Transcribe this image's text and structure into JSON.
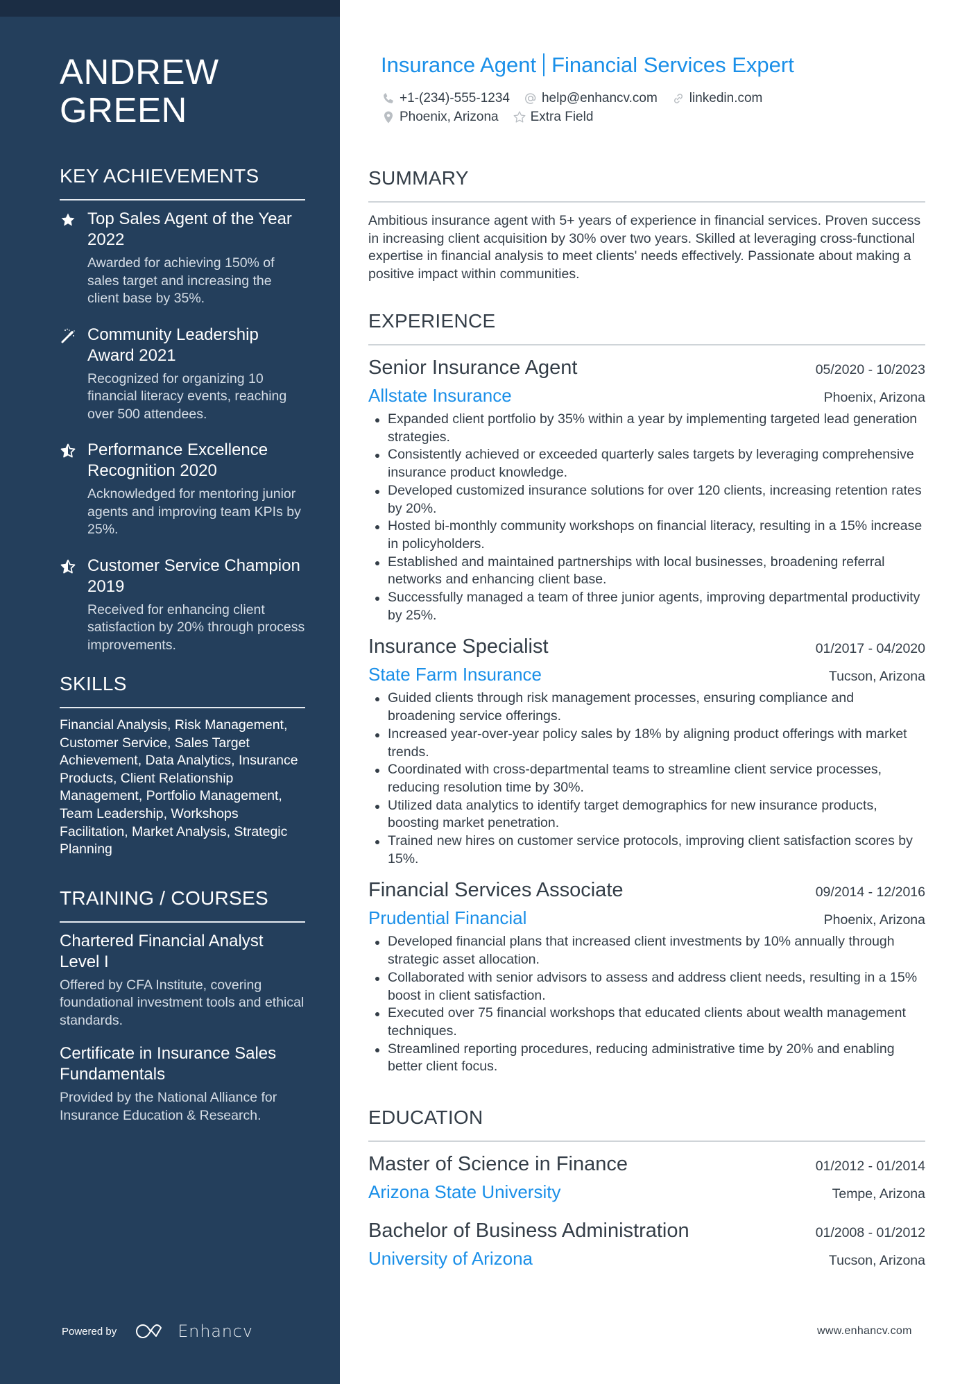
{
  "person": {
    "first_name": "ANDREW",
    "last_name": "GREEN",
    "title_part1": "Insurance Agent",
    "title_part2": "Financial Services Expert"
  },
  "contacts": {
    "phone": {
      "icon": "phone-icon",
      "value": "+1-(234)-555-1234"
    },
    "email": {
      "icon": "at-icon",
      "value": "help@enhancv.com"
    },
    "link": {
      "icon": "link-icon",
      "value": "linkedin.com"
    },
    "location": {
      "icon": "location-pin-icon",
      "value": "Phoenix, Arizona"
    },
    "extra": {
      "icon": "star-outline-icon",
      "value": "Extra Field"
    }
  },
  "sidebar": {
    "achievements": {
      "heading": "KEY ACHIEVEMENTS",
      "items": [
        {
          "icon": "star-filled-icon",
          "title": "Top Sales Agent of the Year 2022",
          "description": "Awarded for achieving 150% of sales target and increasing the client base by 35%."
        },
        {
          "icon": "magic-wand-icon",
          "title": "Community Leadership Award 2021",
          "description": "Recognized for organizing 10 financial literacy events, reaching over 500 attendees."
        },
        {
          "icon": "star-half-icon",
          "title": "Performance Excellence Recognition 2020",
          "description": "Acknowledged for mentoring junior agents and improving team KPIs by 25%."
        },
        {
          "icon": "star-half-icon",
          "title": "Customer Service Champion 2019",
          "description": "Received for enhancing client satisfaction by 20% through process improvements."
        }
      ]
    },
    "skills": {
      "heading": "SKILLS",
      "text": "Financial Analysis, Risk Management, Customer Service, Sales Target Achievement, Data Analytics, Insurance Products, Client Relationship Management, Portfolio Management, Team Leadership, Workshops Facilitation, Market Analysis, Strategic Planning"
    },
    "training": {
      "heading": "TRAINING / COURSES",
      "items": [
        {
          "title": "Chartered Financial Analyst Level I",
          "description": "Offered by CFA Institute, covering foundational investment tools and ethical standards."
        },
        {
          "title": "Certificate in Insurance Sales Fundamentals",
          "description": "Provided by the National Alliance for Insurance Education & Research."
        }
      ]
    },
    "footer": {
      "powered_label": "Powered by",
      "brand": "Enhancv"
    }
  },
  "summary": {
    "heading": "SUMMARY",
    "text": "Ambitious insurance agent with 5+ years of experience in financial services. Proven success in increasing client acquisition by 30% over two years. Skilled at leveraging cross-functional expertise in financial analysis to meet clients' needs effectively. Passionate about making a positive impact within communities."
  },
  "experience": {
    "heading": "EXPERIENCE",
    "jobs": [
      {
        "title": "Senior Insurance Agent",
        "dates": "05/2020 - 10/2023",
        "company": "Allstate Insurance",
        "location": "Phoenix, Arizona",
        "bullets": [
          "Expanded client portfolio by 35% within a year by implementing targeted lead generation strategies.",
          "Consistently achieved or exceeded quarterly sales targets by leveraging comprehensive insurance product knowledge.",
          "Developed customized insurance solutions for over 120 clients, increasing retention rates by 20%.",
          "Hosted bi-monthly community workshops on financial literacy, resulting in a 15% increase in policyholders.",
          "Established and maintained partnerships with local businesses, broadening referral networks and enhancing client base.",
          "Successfully managed a team of three junior agents, improving departmental productivity by 25%."
        ]
      },
      {
        "title": "Insurance Specialist",
        "dates": "01/2017 - 04/2020",
        "company": "State Farm Insurance",
        "location": "Tucson, Arizona",
        "bullets": [
          "Guided clients through risk management processes, ensuring compliance and broadening service offerings.",
          "Increased year-over-year policy sales by 18% by aligning product offerings with market trends.",
          "Coordinated with cross-departmental teams to streamline client service processes, reducing resolution time by 30%.",
          "Utilized data analytics to identify target demographics for new insurance products, boosting market penetration.",
          "Trained new hires on customer service protocols, improving client satisfaction scores by 15%."
        ]
      },
      {
        "title": "Financial Services Associate",
        "dates": "09/2014 - 12/2016",
        "company": "Prudential Financial",
        "location": "Phoenix, Arizona",
        "bullets": [
          "Developed financial plans that increased client investments by 10% annually through strategic asset allocation.",
          "Collaborated with senior advisors to assess and address client needs, resulting in a 15% boost in client satisfaction.",
          "Executed over 75 financial workshops that educated clients about wealth management techniques.",
          "Streamlined reporting procedures, reducing administrative time by 20% and enabling better client focus."
        ]
      }
    ]
  },
  "education": {
    "heading": "EDUCATION",
    "items": [
      {
        "degree": "Master of Science in Finance",
        "dates": "01/2012 - 01/2014",
        "school": "Arizona State University",
        "location": "Tempe, Arizona"
      },
      {
        "degree": "Bachelor of Business Administration",
        "dates": "01/2008 - 01/2012",
        "school": "University of Arizona",
        "location": "Tucson, Arizona"
      }
    ]
  },
  "footer": {
    "website": "www.enhancv.com"
  },
  "colors": {
    "sidebar_bg": "#243f5c",
    "sidebar_top_strip": "#1b2d44",
    "accent": "#1a8fe8",
    "body_text": "#333d47"
  }
}
